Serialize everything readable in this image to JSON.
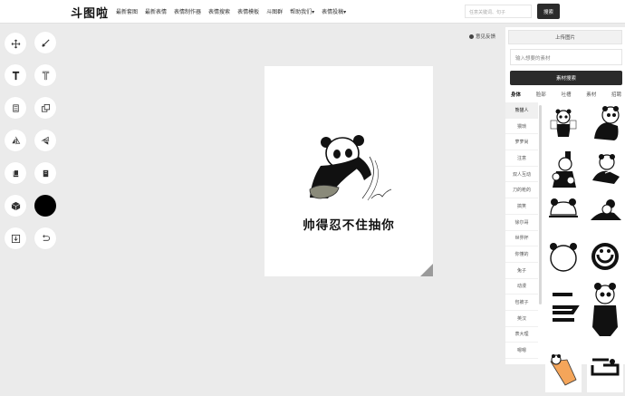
{
  "header": {
    "logo": "斗图啦",
    "nav": [
      "最新套图",
      "最新表情",
      "表情制作器",
      "表情搜索",
      "表情模板",
      "斗图群",
      "帮助我们▾",
      "表情投稿▾"
    ],
    "search_placeholder": "任意关键词、句子",
    "search_button": "搜索"
  },
  "toolbar": {
    "icons": [
      "move-icon",
      "pen-icon",
      "text-bold-icon",
      "text-stroke-icon",
      "layer-icon",
      "copy-icon",
      "flip-icon",
      "flip-vertical-icon",
      "bring-front-icon",
      "send-back-icon",
      "cube-icon",
      "color-picker",
      "download-icon",
      "undo-icon"
    ],
    "color_value": "#000000"
  },
  "canvas": {
    "caption": "帅得忍不住抽你"
  },
  "feedback": "意见反馈",
  "panel": {
    "upload_label": "上传图片",
    "material_placeholder": "输入想要的素材",
    "material_search": "素材搜索",
    "tabs": [
      "身体",
      "脸部",
      "吐槽",
      "素材",
      "招聘"
    ],
    "active_tab": "身体",
    "categories": [
      "熊猫人",
      "猥琐",
      "萝萝尚",
      "注意",
      "双人互动",
      "刀的枪的",
      "搞笑",
      "徐尔哥",
      "世界杯",
      "你懂的",
      "兔子",
      "动漫",
      "包被子",
      "英汉",
      "表大理",
      "嗯嗯"
    ],
    "active_category": "熊猫人"
  },
  "colors": {
    "dark_button": "#2b2b2b",
    "background": "#ebebeb"
  }
}
